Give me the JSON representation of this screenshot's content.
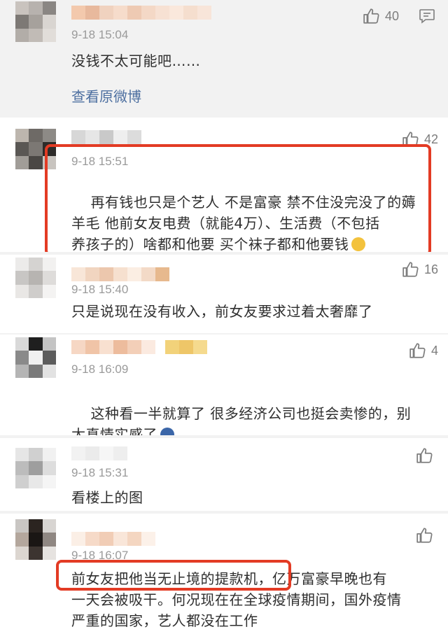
{
  "colors": {
    "highlight": "#e33b24",
    "link": "#4d6fa0",
    "time": "#9a9a9a"
  },
  "comments": [
    {
      "time": "9-18 15:04",
      "text": "没钱不太可能吧……",
      "likes": "40",
      "view_original": "查看原微博"
    },
    {
      "time": "9-18 15:51",
      "text": "再有钱也只是个艺人 不是富豪 禁不住没完没了的薅\n羊毛 他前女友电费（就能4万）、生活费（不包括\n养孩子的）啥都和他要 买个袜子都和他要钱",
      "likes": "42"
    },
    {
      "time": "9-18 15:40",
      "text": "只是说现在没有收入，前女友要求过着太奢靡了",
      "likes": "16"
    },
    {
      "time": "9-18 16:09",
      "text": "这种看一半就算了 很多经济公司也挺会卖惨的，别\n太真情实感了",
      "likes": "4"
    },
    {
      "time": "9-18 15:31",
      "text": "看楼上的图",
      "likes": ""
    },
    {
      "time": "9-18 16:07",
      "text": "前女友把他当无止境的提款机，亿万富豪早晚也有\n一天会被吸干。何况现在在全球疫情期间，国外疫情\n严重的国家，艺人都没在工作",
      "likes": ""
    }
  ]
}
